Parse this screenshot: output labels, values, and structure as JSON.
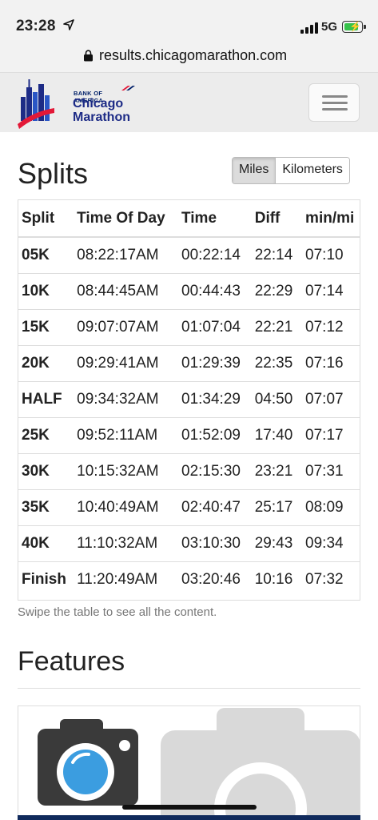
{
  "status_bar": {
    "time": "23:28",
    "network": "5G"
  },
  "browser": {
    "url": "results.chicagomarathon.com"
  },
  "logo": {
    "sponsor": "BANK OF AMERICA",
    "line1": "Chicago",
    "line2": "Marathon"
  },
  "splits": {
    "title": "Splits",
    "units": [
      "Miles",
      "Kilometers"
    ],
    "selected_unit": "Miles",
    "columns": [
      "Split",
      "Time Of Day",
      "Time",
      "Diff",
      "min/mi"
    ],
    "rows": [
      {
        "split": "05K",
        "tod": "08:22:17AM",
        "time": "00:22:14",
        "diff": "22:14",
        "pace": "07:10"
      },
      {
        "split": "10K",
        "tod": "08:44:45AM",
        "time": "00:44:43",
        "diff": "22:29",
        "pace": "07:14"
      },
      {
        "split": "15K",
        "tod": "09:07:07AM",
        "time": "01:07:04",
        "diff": "22:21",
        "pace": "07:12"
      },
      {
        "split": "20K",
        "tod": "09:29:41AM",
        "time": "01:29:39",
        "diff": "22:35",
        "pace": "07:16"
      },
      {
        "split": "HALF",
        "tod": "09:34:32AM",
        "time": "01:34:29",
        "diff": "04:50",
        "pace": "07:07"
      },
      {
        "split": "25K",
        "tod": "09:52:11AM",
        "time": "01:52:09",
        "diff": "17:40",
        "pace": "07:17"
      },
      {
        "split": "30K",
        "tod": "10:15:32AM",
        "time": "02:15:30",
        "diff": "23:21",
        "pace": "07:31"
      },
      {
        "split": "35K",
        "tod": "10:40:49AM",
        "time": "02:40:47",
        "diff": "25:17",
        "pace": "08:09"
      },
      {
        "split": "40K",
        "tod": "11:10:32AM",
        "time": "03:10:30",
        "diff": "29:43",
        "pace": "09:34"
      },
      {
        "split": "Finish",
        "tod": "11:20:49AM",
        "time": "03:20:46",
        "diff": "10:16",
        "pace": "07:32"
      }
    ],
    "hint": "Swipe the table to see all the content."
  },
  "features": {
    "title": "Features"
  },
  "colors": {
    "brand_navy": "#1d2b86",
    "brand_red": "#e31837",
    "camera_blue": "#3b9de0"
  }
}
